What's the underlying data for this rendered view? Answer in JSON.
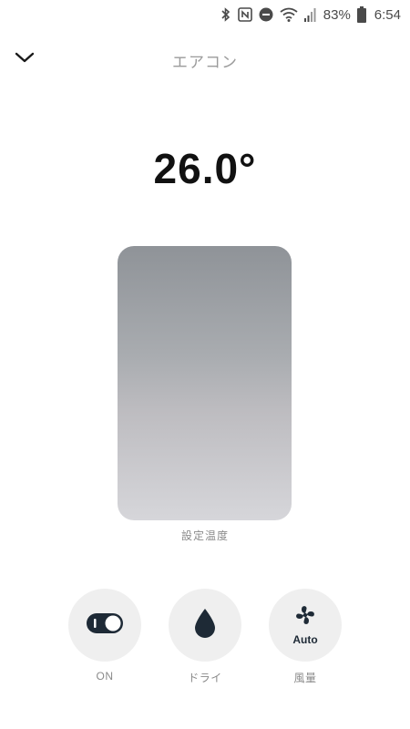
{
  "status_bar": {
    "battery_percent": "83%",
    "time": "6:54",
    "icons": [
      "bluetooth-icon",
      "nfc-icon",
      "do-not-disturb-icon",
      "wifi-icon",
      "signal-icon",
      "battery-icon"
    ]
  },
  "header": {
    "title": "エアコン",
    "back_icon": "chevron-down-icon"
  },
  "temperature": {
    "value": "26.0°",
    "slider_label": "設定温度"
  },
  "controls": {
    "power": {
      "label": "ON",
      "icon": "toggle-icon"
    },
    "mode": {
      "label": "ドライ",
      "icon": "water-drop-icon"
    },
    "fan": {
      "label": "風量",
      "value": "Auto",
      "icon": "fan-icon"
    }
  },
  "colors": {
    "accent_dark": "#1e2a36",
    "button_bg": "#efefef",
    "label_gray": "#8a8a8a"
  }
}
